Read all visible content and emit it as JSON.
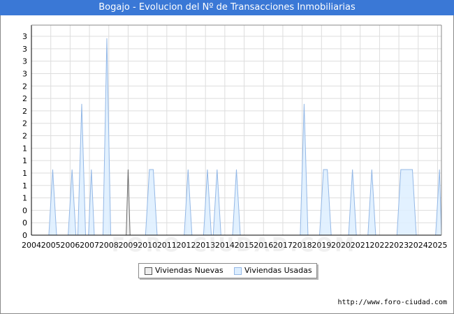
{
  "header": {
    "title": "Bogajo - Evolucion del Nº de Transacciones Inmobiliarias"
  },
  "watermark": "FORO-CIUDAD.COM",
  "footer": {
    "url": "http://www.foro-ciudad.com"
  },
  "legend": {
    "nuevas_label": "Viviendas Nuevas",
    "usadas_label": "Viviendas Usadas"
  },
  "colors": {
    "title_bg": "#3a78d6",
    "nuevas_fill": "#eeeeee",
    "nuevas_stroke": "#666666",
    "usadas_fill": "#ddeeff",
    "usadas_stroke": "#94b8e6",
    "grid": "#dddddd"
  },
  "chart_data": {
    "type": "area",
    "title": "Bogajo - Evolucion del Nº de Transacciones Inmobiliarias",
    "xlabel": "",
    "ylabel": "",
    "x_ticks": [
      "2004",
      "2005",
      "2006",
      "2007",
      "2008",
      "2009",
      "2010",
      "2011",
      "2012",
      "2013",
      "2014",
      "2015",
      "2016",
      "2017",
      "2018",
      "2019",
      "2020",
      "2021",
      "2022",
      "2023",
      "2024",
      "2025"
    ],
    "y_tick_labels": [
      "0",
      "0",
      "0",
      "1",
      "1",
      "1",
      "1",
      "1",
      "2",
      "2",
      "2",
      "2",
      "2",
      "3",
      "3",
      "3",
      "3"
    ],
    "ylim": [
      0,
      3.2
    ],
    "xlim": [
      2004,
      2025.2
    ],
    "grid": true,
    "legend_position": "bottom",
    "series": [
      {
        "name": "Viviendas Nuevas",
        "color": "#666666",
        "fill": "#eeeeee",
        "points": [
          [
            2008.9,
            0
          ],
          [
            2009.0,
            1
          ],
          [
            2009.1,
            0
          ]
        ]
      },
      {
        "name": "Viviendas Usadas",
        "color": "#94b8e6",
        "fill": "#ddeeff",
        "points": [
          [
            2004.9,
            0
          ],
          [
            2005.1,
            1
          ],
          [
            2005.3,
            0
          ],
          [
            2005.9,
            0
          ],
          [
            2006.1,
            1
          ],
          [
            2006.3,
            0
          ],
          [
            2006.4,
            0
          ],
          [
            2006.6,
            2
          ],
          [
            2006.8,
            0
          ],
          [
            2006.95,
            0
          ],
          [
            2007.1,
            1
          ],
          [
            2007.25,
            0
          ],
          [
            2007.7,
            0
          ],
          [
            2007.9,
            3
          ],
          [
            2008.1,
            0
          ],
          [
            2009.9,
            0
          ],
          [
            2010.1,
            1
          ],
          [
            2010.3,
            1
          ],
          [
            2010.5,
            0
          ],
          [
            2011.9,
            0
          ],
          [
            2012.1,
            1
          ],
          [
            2012.3,
            0
          ],
          [
            2012.9,
            0
          ],
          [
            2013.1,
            1
          ],
          [
            2013.3,
            0
          ],
          [
            2013.4,
            0
          ],
          [
            2013.6,
            1
          ],
          [
            2013.8,
            0
          ],
          [
            2014.4,
            0
          ],
          [
            2014.6,
            1
          ],
          [
            2014.8,
            0
          ],
          [
            2017.9,
            0
          ],
          [
            2018.1,
            2
          ],
          [
            2018.3,
            0
          ],
          [
            2018.9,
            0
          ],
          [
            2019.1,
            1
          ],
          [
            2019.3,
            1
          ],
          [
            2019.5,
            0
          ],
          [
            2020.4,
            0
          ],
          [
            2020.6,
            1
          ],
          [
            2020.8,
            0
          ],
          [
            2021.4,
            0
          ],
          [
            2021.6,
            1
          ],
          [
            2021.8,
            0
          ],
          [
            2022.9,
            0
          ],
          [
            2023.1,
            1
          ],
          [
            2023.7,
            1
          ],
          [
            2023.9,
            0
          ],
          [
            2024.9,
            0
          ],
          [
            2025.1,
            1
          ],
          [
            2025.2,
            0
          ]
        ]
      }
    ]
  }
}
